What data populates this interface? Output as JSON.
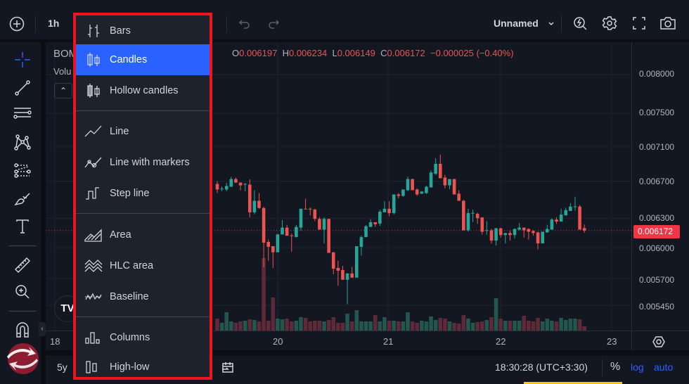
{
  "topbar": {
    "interval": "1h",
    "layout_name": "Unnamed"
  },
  "legend": {
    "symbol": "BOM",
    "volume": "Volu",
    "ohlc": {
      "o_label": "O",
      "o": "0.006197",
      "h_label": "H",
      "h": "0.006234",
      "l_label": "L",
      "l": "0.006149",
      "c_label": "C",
      "c": "0.006172",
      "change": "−0.000025 (−0.40%)"
    }
  },
  "chart_type_menu": {
    "items": [
      {
        "label": "Bars",
        "icon": "bars-icon"
      },
      {
        "label": "Candles",
        "icon": "candles-icon",
        "selected": true
      },
      {
        "label": "Hollow candles",
        "icon": "hollow-candles-icon"
      },
      {
        "label": "Line",
        "icon": "line-icon"
      },
      {
        "label": "Line with markers",
        "icon": "line-markers-icon"
      },
      {
        "label": "Step line",
        "icon": "step-line-icon"
      },
      {
        "label": "Area",
        "icon": "area-icon"
      },
      {
        "label": "HLC area",
        "icon": "hlc-area-icon"
      },
      {
        "label": "Baseline",
        "icon": "baseline-icon"
      },
      {
        "label": "Columns",
        "icon": "columns-icon"
      },
      {
        "label": "High-low",
        "icon": "high-low-icon"
      }
    ]
  },
  "price_axis": {
    "ticks": [
      "0.008000",
      "0.007500",
      "0.007100",
      "0.006700",
      "0.006300",
      "0.006000",
      "0.005700",
      "0.005450"
    ],
    "last_price": "0.006172",
    "last_price_color": "#f23645"
  },
  "time_axis": {
    "ticks": [
      "18",
      "20",
      "21",
      "22",
      "23"
    ]
  },
  "bottombar": {
    "range": "5y",
    "clock": "18:30:28 (UTC+3:30)",
    "percent": "%",
    "log": "log",
    "auto": "auto"
  },
  "colors": {
    "up": "#26a69a",
    "down": "#ef5350",
    "accent": "#2962ff",
    "highlight_border": "#f0141e"
  },
  "chart_data": {
    "type": "candlestick",
    "scale": "log",
    "ylim": [
      0.00535,
      0.0082
    ],
    "x_ticks": [
      "18",
      "20",
      "21",
      "22",
      "23"
    ],
    "y_ticks": [
      0.008,
      0.0075,
      0.0071,
      0.0067,
      0.0063,
      0.006,
      0.0057,
      0.00545
    ],
    "grid": true,
    "candles": [
      [
        0.006669,
        0.0067,
        0.00657,
        0.006608
      ],
      [
        0.006612,
        0.00664,
        0.00659,
        0.006618
      ],
      [
        0.006608,
        0.00668,
        0.00659,
        0.006646
      ],
      [
        0.006638,
        0.00675,
        0.006638,
        0.006724
      ],
      [
        0.006724,
        0.00674,
        0.00668,
        0.006685
      ],
      [
        0.006685,
        0.006685,
        0.0066,
        0.006654
      ],
      [
        0.006665,
        0.00668,
        0.00659,
        0.006669
      ],
      [
        0.006662,
        0.00672,
        0.00631,
        0.006362
      ],
      [
        0.006362,
        0.0066,
        0.00634,
        0.006485
      ],
      [
        0.006485,
        0.00657,
        0.0064,
        0.006408
      ],
      [
        0.006408,
        0.00642,
        0.005806,
        0.006049
      ],
      [
        0.006056,
        0.00608,
        0.00587,
        0.006007
      ],
      [
        0.006014,
        0.006014,
        0.0058,
        0.005953
      ],
      [
        0.005953,
        0.00614,
        0.005953,
        0.006132
      ],
      [
        0.006132,
        0.00628,
        0.006132,
        0.006202
      ],
      [
        0.006202,
        0.00623,
        0.006119,
        0.006119
      ],
      [
        0.006122,
        0.00614,
        0.00596,
        0.006116
      ],
      [
        0.006105,
        0.00623,
        0.006105,
        0.006209
      ],
      [
        0.006202,
        0.0064,
        0.00617,
        0.0064
      ],
      [
        0.0064,
        0.006508,
        0.006395,
        0.006398
      ],
      [
        0.0064,
        0.006415,
        0.00633,
        0.006395
      ],
      [
        0.006392,
        0.0064,
        0.00627,
        0.006293
      ],
      [
        0.006293,
        0.00631,
        0.006181,
        0.006181
      ],
      [
        0.006181,
        0.00631,
        0.00604,
        0.006293
      ],
      [
        0.006293,
        0.006293,
        0.005947,
        0.005947
      ],
      [
        0.005953,
        0.005953,
        0.00574,
        0.005793
      ],
      [
        0.0058,
        0.00587,
        0.00563,
        0.005773
      ],
      [
        0.00578,
        0.00582,
        0.005687,
        0.005687
      ],
      [
        0.005687,
        0.00575,
        0.00546,
        0.005747
      ],
      [
        0.005747,
        0.00581,
        0.005707,
        0.005707
      ],
      [
        0.005707,
        0.006014,
        0.005707,
        0.006014
      ],
      [
        0.006007,
        0.00612,
        0.00592,
        0.006105
      ],
      [
        0.006105,
        0.00623,
        0.006105,
        0.006216
      ],
      [
        0.006209,
        0.00629,
        0.006209,
        0.006258
      ],
      [
        0.006258,
        0.006258,
        0.00621,
        0.006237
      ],
      [
        0.006244,
        0.00639,
        0.00622,
        0.006369
      ],
      [
        0.006362,
        0.00648,
        0.006362,
        0.0064
      ],
      [
        0.0064,
        0.00648,
        0.00632,
        0.006354
      ],
      [
        0.006354,
        0.006554,
        0.00634,
        0.006554
      ],
      [
        0.006554,
        0.00657,
        0.00651,
        0.006538
      ],
      [
        0.006538,
        0.006608,
        0.00653,
        0.006608
      ],
      [
        0.0066,
        0.00675,
        0.00659,
        0.006724
      ],
      [
        0.006724,
        0.006724,
        0.0066,
        0.0066
      ],
      [
        0.006608,
        0.00662,
        0.00654,
        0.006554
      ],
      [
        0.006562,
        0.00659,
        0.00656,
        0.006585
      ],
      [
        0.006569,
        0.00665,
        0.00656,
        0.006638
      ],
      [
        0.006631,
        0.00682,
        0.006631,
        0.006798
      ],
      [
        0.006782,
        0.00696,
        0.00677,
        0.006896
      ],
      [
        0.006896,
        0.007002,
        0.006733,
        0.006733
      ],
      [
        0.006741,
        0.00677,
        0.00662,
        0.006654
      ],
      [
        0.006654,
        0.006724,
        0.00661,
        0.006724
      ],
      [
        0.006724,
        0.006724,
        0.006554,
        0.006554
      ],
      [
        0.006562,
        0.0066,
        0.006485,
        0.006485
      ],
      [
        0.006485,
        0.006495,
        0.006174,
        0.006174
      ],
      [
        0.006174,
        0.0064,
        0.00616,
        0.006354
      ],
      [
        0.00635,
        0.00639,
        0.00626,
        0.006356
      ],
      [
        0.006346,
        0.00636,
        0.00624,
        0.0063
      ],
      [
        0.006308,
        0.00631,
        0.00613,
        0.00616
      ],
      [
        0.006172,
        0.00627,
        0.00613,
        0.006176
      ],
      [
        0.006174,
        0.00619,
        0.00604,
        0.00607
      ],
      [
        0.00607,
        0.0062,
        0.00602,
        0.006195
      ],
      [
        0.006195,
        0.0062,
        0.0061,
        0.006126
      ],
      [
        0.006126,
        0.00615,
        0.00604,
        0.006146
      ],
      [
        0.006146,
        0.00617,
        0.00607,
        0.006126
      ],
      [
        0.006126,
        0.006195,
        0.00609,
        0.006188
      ],
      [
        0.006181,
        0.00625,
        0.006175,
        0.006202
      ],
      [
        0.006202,
        0.006202,
        0.0061,
        0.006174
      ],
      [
        0.006188,
        0.006195,
        0.00608,
        0.00616
      ],
      [
        0.006167,
        0.006175,
        0.00612,
        0.006146
      ],
      [
        0.006153,
        0.00616,
        0.00598,
        0.006042
      ],
      [
        0.006042,
        0.00616,
        0.006042,
        0.00616
      ],
      [
        0.006153,
        0.00623,
        0.00615,
        0.006188
      ],
      [
        0.006181,
        0.0063,
        0.006181,
        0.006286
      ],
      [
        0.006286,
        0.00631,
        0.00624,
        0.006265
      ],
      [
        0.006265,
        0.0064,
        0.006265,
        0.006338
      ],
      [
        0.006331,
        0.00641,
        0.006325,
        0.006385
      ],
      [
        0.006377,
        0.00646,
        0.006377,
        0.006423
      ],
      [
        0.00642,
        0.00653,
        0.00638,
        0.006425
      ],
      [
        0.006423,
        0.00644,
        0.006181,
        0.006181
      ],
      [
        0.006197,
        0.006234,
        0.006149,
        0.006172
      ]
    ],
    "volume_relative": [
      17,
      11,
      26,
      13,
      11,
      13,
      14,
      16,
      15,
      13,
      103,
      14,
      47,
      17,
      16,
      17,
      13,
      14,
      19,
      18,
      13,
      14,
      14,
      13,
      15,
      19,
      11,
      11,
      24,
      13,
      29,
      13,
      13,
      13,
      22,
      13,
      19,
      14,
      14,
      13,
      13,
      26,
      13,
      11,
      14,
      13,
      20,
      15,
      18,
      17,
      13,
      11,
      10,
      22,
      17,
      11,
      12,
      13,
      15,
      19,
      46,
      17,
      14,
      14,
      14,
      14,
      21,
      14,
      13,
      18,
      13,
      17,
      14,
      13,
      18,
      15,
      17,
      17,
      16,
      6
    ]
  }
}
